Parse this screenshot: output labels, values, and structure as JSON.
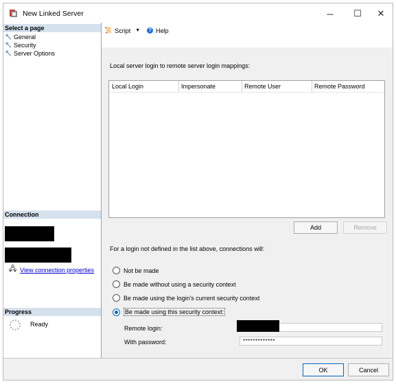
{
  "window": {
    "title": "New Linked Server",
    "controls": {
      "minimize": "─",
      "maximize": "☐",
      "close": "✕"
    }
  },
  "left_pane": {
    "select_page_header": "Select a page",
    "pages": [
      {
        "label": "General",
        "icon": "wrench-icon"
      },
      {
        "label": "Security",
        "icon": "wrench-icon"
      },
      {
        "label": "Server Options",
        "icon": "wrench-icon"
      }
    ],
    "connection_header": "Connection",
    "view_connection_properties": "View connection properties",
    "progress_header": "Progress",
    "progress_status": "Ready"
  },
  "toolbar": {
    "script_label": "Script",
    "help_label": "Help"
  },
  "security": {
    "mappings_label": "Local server login to remote server login mappings:",
    "columns": [
      "Local Login",
      "Impersonate",
      "Remote User",
      "Remote Password"
    ],
    "add_button": "Add",
    "remove_button": "Remove",
    "not_defined_label": "For a login not defined in the list above, connections will:",
    "options": [
      {
        "label": "Not be made",
        "selected": false
      },
      {
        "label": "Be made without using a security context",
        "selected": false
      },
      {
        "label": "Be made using the login's current security context",
        "selected": false
      },
      {
        "label": "Be made using this security context:",
        "selected": true
      }
    ],
    "remote_login_label": "Remote login:",
    "remote_login_value": "",
    "with_password_label": "With password:",
    "with_password_value": "*************"
  },
  "footer": {
    "ok_button": "OK",
    "cancel_button": "Cancel"
  },
  "colors": {
    "section_header": "#d6e1ee",
    "accent": "#0067c0",
    "link": "#0000cc"
  }
}
